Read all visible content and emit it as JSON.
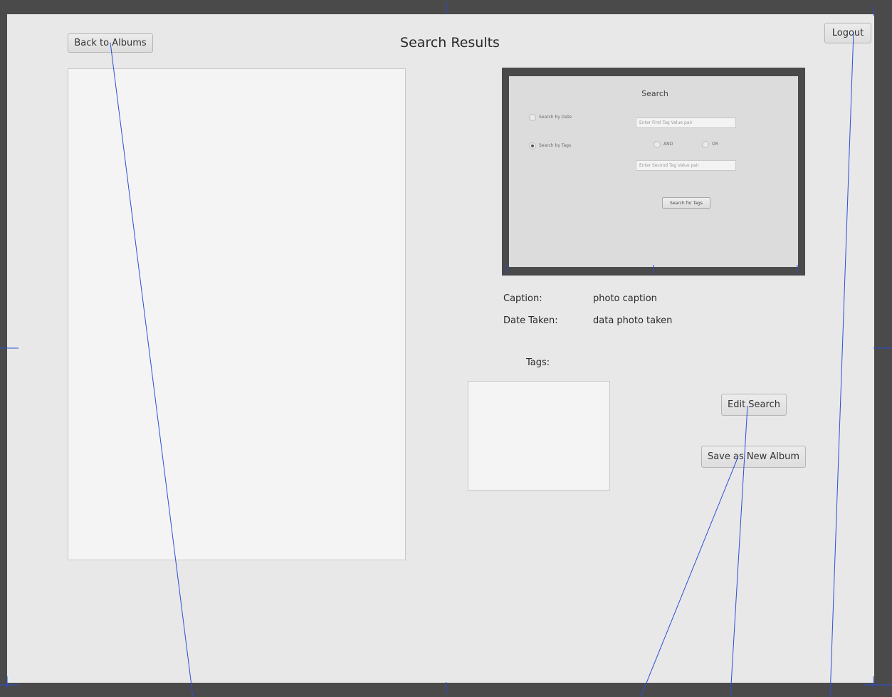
{
  "header": {
    "title": "Search Results",
    "back_label": "Back to Albums",
    "logout_label": "Logout"
  },
  "search_preview": {
    "title": "Search",
    "search_by_date_label": "Search by Date",
    "search_by_tags_label": "Search by Tags",
    "first_tag_placeholder": "Enter First Tag Value pair",
    "and_label": "AND",
    "or_label": "OR",
    "second_tag_placeholder": "Enter Second Tag Value pair",
    "search_button_label": "Search for Tags",
    "selected_mode": "Search by Tags"
  },
  "details": {
    "caption_label": "Caption:",
    "caption_value": "photo caption",
    "date_label": "Date Taken:",
    "date_value": "data photo taken",
    "tags_label": "Tags:"
  },
  "actions": {
    "edit_search_label": "Edit Search",
    "save_album_label": "Save as New Album"
  },
  "colors": {
    "window_border": "#4a4a4a",
    "background": "#e8e8e8",
    "panel": "#f4f4f4",
    "annotation_line": "#2b4fd8"
  }
}
